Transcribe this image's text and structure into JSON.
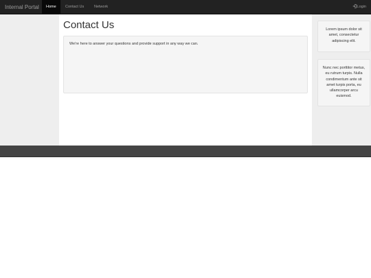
{
  "navbar": {
    "brand": "Internal Portal",
    "items": [
      {
        "label": "Home",
        "active": true
      },
      {
        "label": "Contact Us",
        "active": false
      },
      {
        "label": "Network",
        "active": false
      }
    ],
    "login": {
      "label": "Login",
      "icon": "login-icon"
    }
  },
  "main": {
    "title": "Contact Us",
    "well_text": "We're here to answer your questions and provide support in any way we can."
  },
  "sidebar": {
    "boxes": [
      {
        "text": "Lorem ipsum dolor sit amet, consectetur adipiscing elit."
      },
      {
        "text": "Nunc nec porttitor metus, eu rutrum turpis. Nulla condimentum ante sit amet turpis porta, eu ullamcorper arcu euismod."
      }
    ]
  },
  "colors": {
    "navbar_bg": "#222222",
    "active_bg": "#080808",
    "side_bg": "#eeeeee",
    "footer_bg": "#444444"
  }
}
